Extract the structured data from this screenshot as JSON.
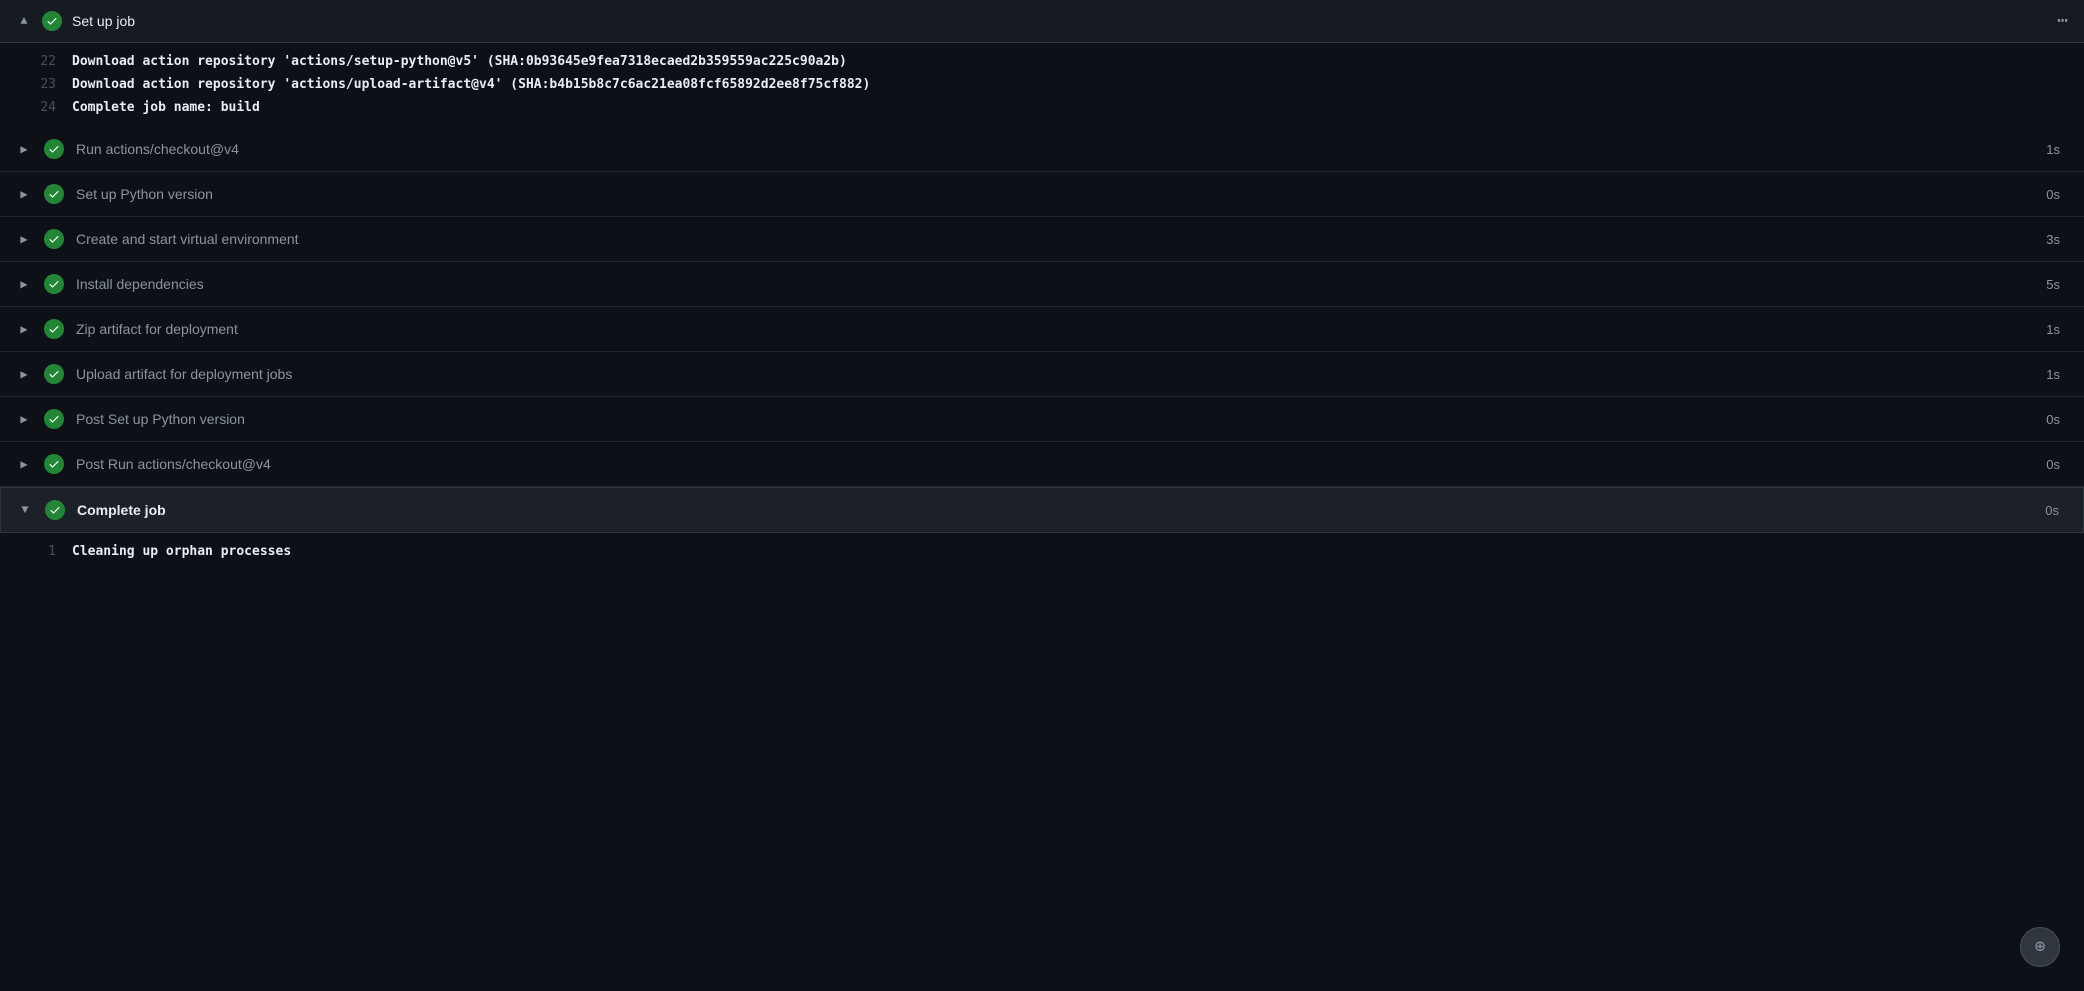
{
  "colors": {
    "bg": "#0d1117",
    "header_bg": "#161b22",
    "active_row_bg": "#1c2128",
    "border": "#30363d",
    "text_primary": "#e6edf3",
    "text_muted": "#8b949e",
    "text_dim": "#484f58",
    "check_green": "#238636"
  },
  "top_header": {
    "title": "Set up job",
    "chevron": "up",
    "more_icon": "⋯"
  },
  "log_lines": [
    {
      "num": "22",
      "text": "Download action repository 'actions/setup-python@v5' (SHA:0b93645e9fea7318ecaed2b359559ac225c90a2b)"
    },
    {
      "num": "23",
      "text": "Download action repository 'actions/upload-artifact@v4' (SHA:b4b15b8c7c6ac21ea08fcf65892d2ee8f75cf882)"
    },
    {
      "num": "24",
      "text": "Complete job name: build"
    }
  ],
  "steps": [
    {
      "id": "run-checkout",
      "label": "Run actions/checkout@v4",
      "duration": "1s",
      "status": "success",
      "expanded": false
    },
    {
      "id": "setup-python",
      "label": "Set up Python version",
      "duration": "0s",
      "status": "success",
      "expanded": false
    },
    {
      "id": "create-venv",
      "label": "Create and start virtual environment",
      "duration": "3s",
      "status": "success",
      "expanded": false
    },
    {
      "id": "install-deps",
      "label": "Install dependencies",
      "duration": "5s",
      "status": "success",
      "expanded": false
    },
    {
      "id": "zip-artifact",
      "label": "Zip artifact for deployment",
      "duration": "1s",
      "status": "success",
      "expanded": false
    },
    {
      "id": "upload-artifact",
      "label": "Upload artifact for deployment jobs",
      "duration": "1s",
      "status": "success",
      "expanded": false
    },
    {
      "id": "post-python",
      "label": "Post Set up Python version",
      "duration": "0s",
      "status": "success",
      "expanded": false
    },
    {
      "id": "post-checkout",
      "label": "Post Run actions/checkout@v4",
      "duration": "0s",
      "status": "success",
      "expanded": false
    }
  ],
  "complete_job": {
    "label": "Complete job",
    "duration": "0s",
    "status": "success",
    "expanded": true
  },
  "complete_log_lines": [
    {
      "num": "1",
      "text": "Cleaning up orphan processes"
    }
  ],
  "scroll_button": {
    "icon": "↓"
  }
}
